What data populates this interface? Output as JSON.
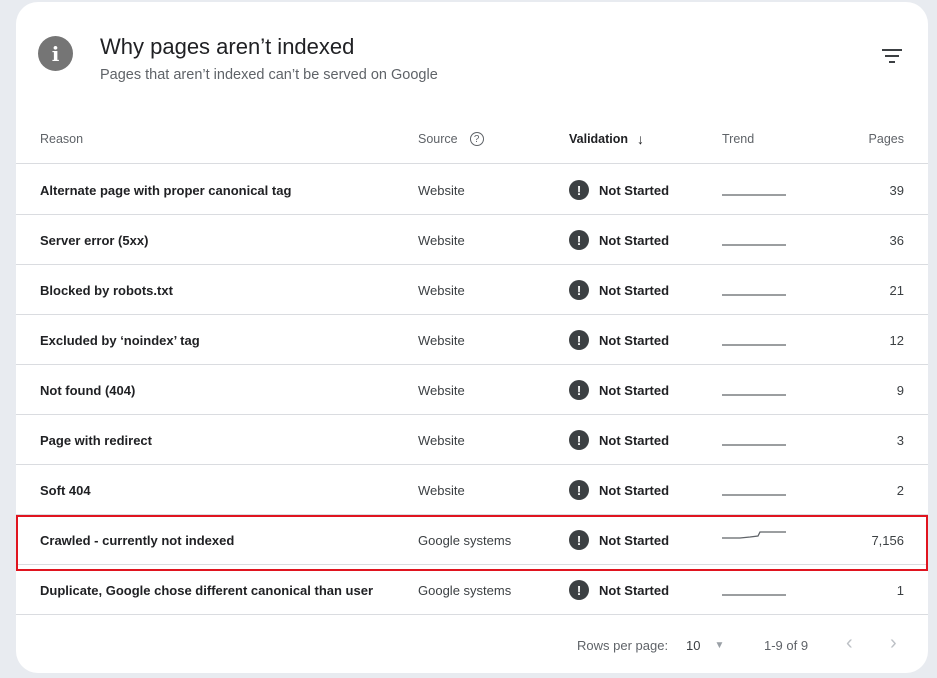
{
  "header": {
    "info_icon": "info-icon",
    "title": "Why pages aren’t indexed",
    "subtitle": "Pages that aren’t indexed can’t be served on Google",
    "filter_icon": "filter-icon"
  },
  "table": {
    "columns": {
      "reason": "Reason",
      "source": "Source",
      "validation": "Validation",
      "trend": "Trend",
      "pages": "Pages"
    },
    "sort_icon": "arrow-down-icon",
    "help_icon": "help-circle-icon",
    "rows": [
      {
        "reason": "Alternate page with proper canonical tag",
        "source": "Website",
        "validation": "Not Started",
        "pages": "39",
        "trend": "flat"
      },
      {
        "reason": "Server error (5xx)",
        "source": "Website",
        "validation": "Not Started",
        "pages": "36",
        "trend": "flat"
      },
      {
        "reason": "Blocked by robots.txt",
        "source": "Website",
        "validation": "Not Started",
        "pages": "21",
        "trend": "flat"
      },
      {
        "reason": "Excluded by ‘noindex’ tag",
        "source": "Website",
        "validation": "Not Started",
        "pages": "12",
        "trend": "flat"
      },
      {
        "reason": "Not found (404)",
        "source": "Website",
        "validation": "Not Started",
        "pages": "9",
        "trend": "flat"
      },
      {
        "reason": "Page with redirect",
        "source": "Website",
        "validation": "Not Started",
        "pages": "3",
        "trend": "flat"
      },
      {
        "reason": "Soft 404",
        "source": "Website",
        "validation": "Not Started",
        "pages": "2",
        "trend": "flat"
      },
      {
        "reason": "Crawled - currently not indexed",
        "source": "Google systems",
        "validation": "Not Started",
        "pages": "7,156",
        "trend": "rising",
        "highlighted": true
      },
      {
        "reason": "Duplicate, Google chose different canonical than user",
        "source": "Google systems",
        "validation": "Not Started",
        "pages": "1",
        "trend": "flat"
      }
    ]
  },
  "pagination": {
    "rows_per_page_label": "Rows per page:",
    "rows_per_page_value": "10",
    "range": "1-9 of 9",
    "prev_icon": "chevron-left-icon",
    "next_icon": "chevron-right-icon"
  },
  "colors": {
    "highlight_border": "#e0141f",
    "status_icon": "#3c4043",
    "divider": "#dadce0"
  }
}
